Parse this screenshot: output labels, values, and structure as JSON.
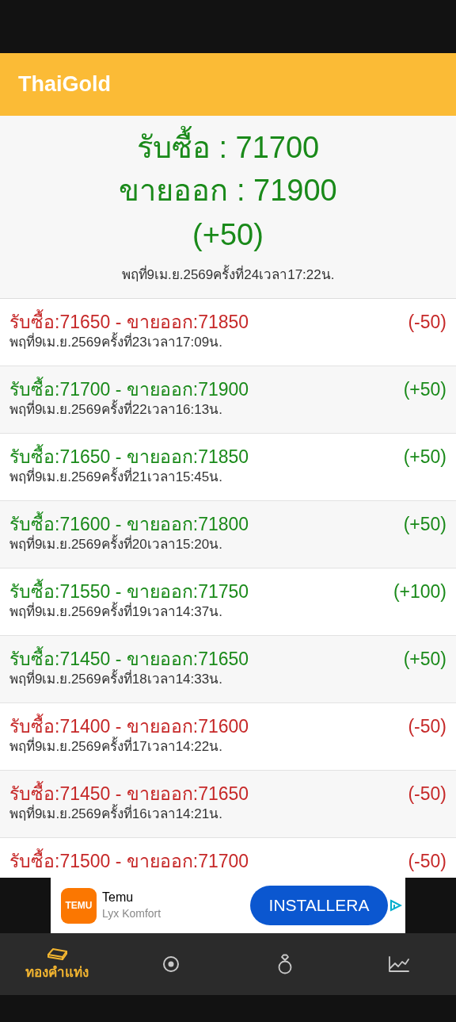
{
  "app_bar": {
    "title": "ThaiGold"
  },
  "current": {
    "buy": "รับซื้อ : 71700",
    "sell": "ขายออก : 71900",
    "change": "(+50)",
    "color": "#1a8a1a",
    "timestamp": "พฤที่9เม.ย.2569ครั้งที่24เวลา17:22น."
  },
  "history": [
    {
      "price": "รับซื้อ:71650 - ขายออก:71850",
      "change": "(-50)",
      "color": "#c62828",
      "timestamp": "พฤที่9เม.ย.2569ครั้งที่23เวลา17:09น."
    },
    {
      "price": "รับซื้อ:71700 - ขายออก:71900",
      "change": "(+50)",
      "color": "#1a8a1a",
      "timestamp": "พฤที่9เม.ย.2569ครั้งที่22เวลา16:13น."
    },
    {
      "price": "รับซื้อ:71650 - ขายออก:71850",
      "change": "(+50)",
      "color": "#1a8a1a",
      "timestamp": "พฤที่9เม.ย.2569ครั้งที่21เวลา15:45น."
    },
    {
      "price": "รับซื้อ:71600 - ขายออก:71800",
      "change": "(+50)",
      "color": "#1a8a1a",
      "timestamp": "พฤที่9เม.ย.2569ครั้งที่20เวลา15:20น."
    },
    {
      "price": "รับซื้อ:71550 - ขายออก:71750",
      "change": "(+100)",
      "color": "#1a8a1a",
      "timestamp": "พฤที่9เม.ย.2569ครั้งที่19เวลา14:37น."
    },
    {
      "price": "รับซื้อ:71450 - ขายออก:71650",
      "change": "(+50)",
      "color": "#1a8a1a",
      "timestamp": "พฤที่9เม.ย.2569ครั้งที่18เวลา14:33น."
    },
    {
      "price": "รับซื้อ:71400 - ขายออก:71600",
      "change": "(-50)",
      "color": "#c62828",
      "timestamp": "พฤที่9เม.ย.2569ครั้งที่17เวลา14:22น."
    },
    {
      "price": "รับซื้อ:71450 - ขายออก:71650",
      "change": "(-50)",
      "color": "#c62828",
      "timestamp": "พฤที่9เม.ย.2569ครั้งที่16เวลา14:21น."
    },
    {
      "price": "รับซื้อ:71500 - ขายออก:71700",
      "change": "(-50)",
      "color": "#c62828"
    }
  ],
  "ad": {
    "logo_text": "TEMU",
    "name": "Temu",
    "subtitle": "Lyx Komfort",
    "button": "INSTALLERA"
  },
  "bottom_nav": [
    {
      "kind": "gold-bar",
      "label": "ทองคำแท่ง",
      "selected": true
    },
    {
      "kind": "target",
      "selected": false
    },
    {
      "kind": "ring",
      "selected": false
    },
    {
      "kind": "chart",
      "selected": false
    }
  ]
}
